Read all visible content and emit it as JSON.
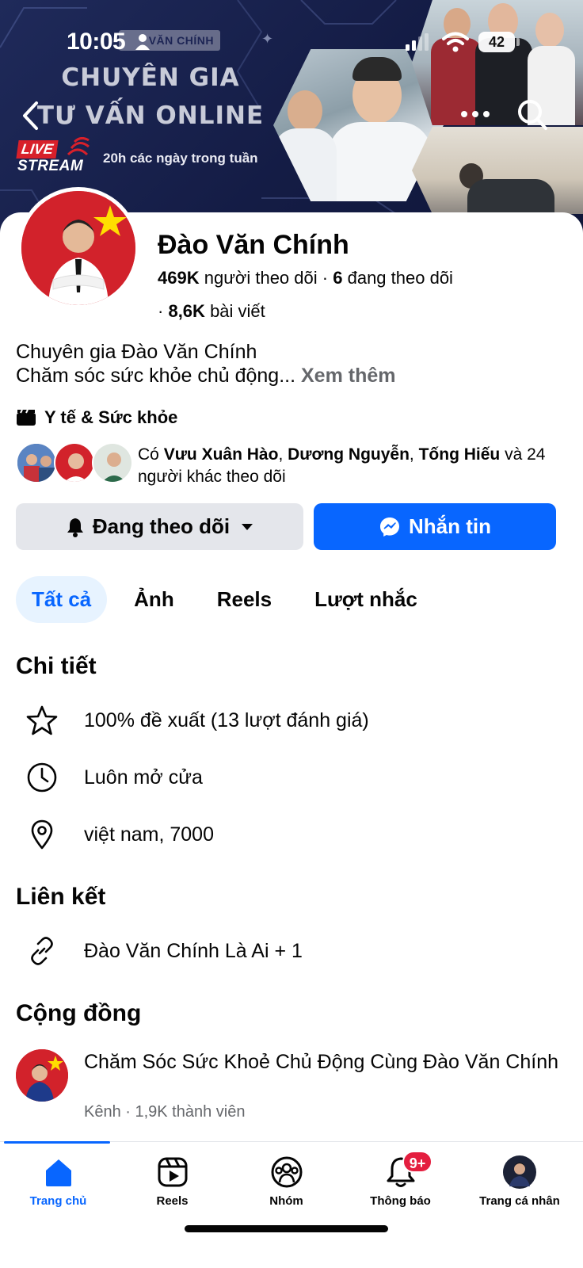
{
  "status_bar": {
    "time": "10:05",
    "battery": "42"
  },
  "cover": {
    "tag": "VĂN CHÍNH",
    "title_line1": "CHUYÊN GIA",
    "title_line2": "TƯ VẤN ONLINE",
    "live_label": "LIVE",
    "stream_label": "STREAM",
    "subtitle": "20h các ngày trong tuần"
  },
  "profile": {
    "name": "Đào Văn Chính",
    "followers_count": "469K",
    "followers_label": "người theo dõi",
    "following_count": "6",
    "following_label": "đang theo dõi",
    "posts_count": "8,6K",
    "posts_label": "bài viết",
    "bio_line1": "Chuyên gia Đào Văn Chính",
    "bio_line2": "Chăm sóc sức khỏe chủ động...",
    "see_more": "Xem thêm",
    "category": "Y tế & Sức khỏe"
  },
  "mutual_followers": {
    "prefix": "Có",
    "name1": "Vưu Xuân Hào",
    "name2": "Dương Nguyễn",
    "name3": "Tống Hiếu",
    "suffix": "và 24 người khác theo dõi"
  },
  "actions": {
    "follow_label": "Đang theo dõi",
    "message_label": "Nhắn tin"
  },
  "tabs": [
    {
      "label": "Tất cả"
    },
    {
      "label": "Ảnh"
    },
    {
      "label": "Reels"
    },
    {
      "label": "Lượt nhắc"
    }
  ],
  "details": {
    "heading": "Chi tiết",
    "rating": "100% đề xuất (13 lượt đánh giá)",
    "hours": "Luôn mở cửa",
    "location": "việt nam, 7000"
  },
  "links": {
    "heading": "Liên kết",
    "link_text": "Đào Văn Chính Là Ai + 1"
  },
  "community": {
    "heading": "Cộng đồng",
    "group_name": "Chăm Sóc Sức Khoẻ Chủ Động Cùng Đào Văn Chính",
    "group_meta": "Kênh · 1,9K thành viên"
  },
  "bottom_nav": {
    "items": [
      {
        "label": "Trang chủ",
        "icon": "home-icon"
      },
      {
        "label": "Reels",
        "icon": "reels-icon"
      },
      {
        "label": "Nhóm",
        "icon": "groups-icon"
      },
      {
        "label": "Thông báo",
        "icon": "bell-icon"
      },
      {
        "label": "Trang cá nhân",
        "icon": "profile-avatar"
      }
    ],
    "notification_badge": "9+"
  },
  "colors": {
    "accent": "#0866ff",
    "badge": "#e41e3f",
    "secondary_text": "#65676b",
    "button_gray": "#e4e6eb"
  }
}
